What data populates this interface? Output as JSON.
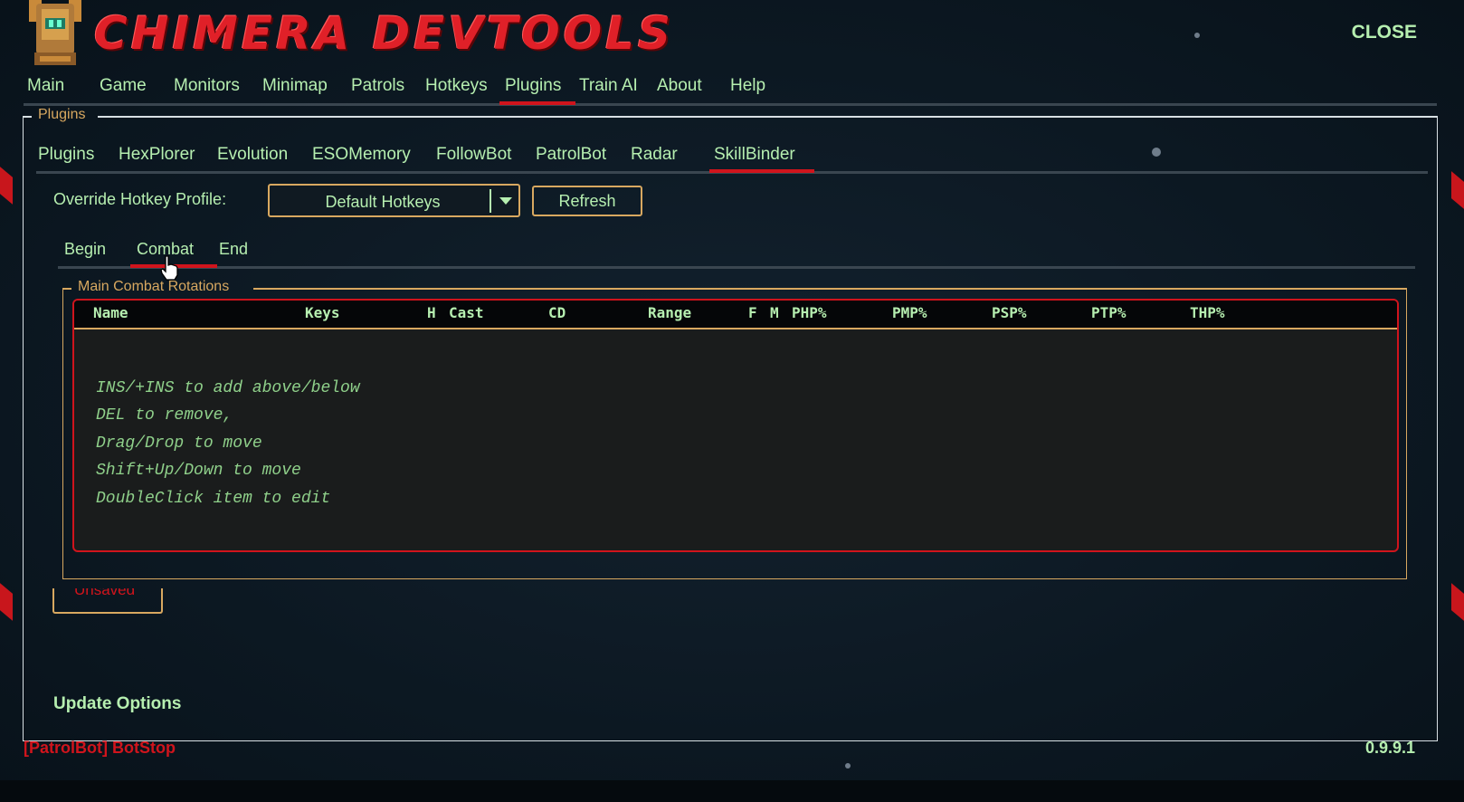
{
  "app": {
    "title": "CHIMERA DEVTOOLS",
    "close_label": "CLOSE"
  },
  "menu": {
    "items": [
      "Main",
      "Game",
      "Monitors",
      "Minimap",
      "Patrols",
      "Hotkeys",
      "Plugins",
      "Train AI",
      "About",
      "Help"
    ],
    "active": "Plugins"
  },
  "plugins_panel": {
    "legend": "Plugins",
    "subtabs": [
      "Plugins",
      "HexPlorer",
      "Evolution",
      "ESOMemory",
      "FollowBot",
      "PatrolBot",
      "Radar",
      "SkillBinder"
    ],
    "active_subtab": "SkillBinder"
  },
  "skillbinder": {
    "override_label": "Override Hotkey Profile:",
    "profile_selected": "Default Hotkeys",
    "refresh_label": "Refresh",
    "phase_tabs": [
      "Begin",
      "Combat",
      "End"
    ],
    "active_phase": "Combat",
    "group_legend": "Main Combat Rotations",
    "columns": [
      "Name",
      "Keys",
      "H",
      "Cast",
      "CD",
      "Range",
      "F",
      "M",
      "PHP%",
      "PMP%",
      "PSP%",
      "PTP%",
      "THP%"
    ],
    "hints": [
      "INS/+INS to add above/below",
      "DEL to remove,",
      "Drag/Drop to move",
      "Shift+Up/Down to move",
      "DoubleClick item to edit"
    ],
    "unsaved_label": "Unsaved"
  },
  "footer": {
    "update_label": "Update Options",
    "status_text": "[PatrolBot] BotStop",
    "version": "0.9.9.1"
  },
  "colors": {
    "accent_red": "#d0141c",
    "text_green": "#b6efb0",
    "border_gold": "#d8a860",
    "background": "#0a1520"
  },
  "icons": {
    "logo": "armored-knight-logo-icon",
    "dropdown": "chevron-down-icon",
    "cursor": "hand-pointer-icon"
  }
}
